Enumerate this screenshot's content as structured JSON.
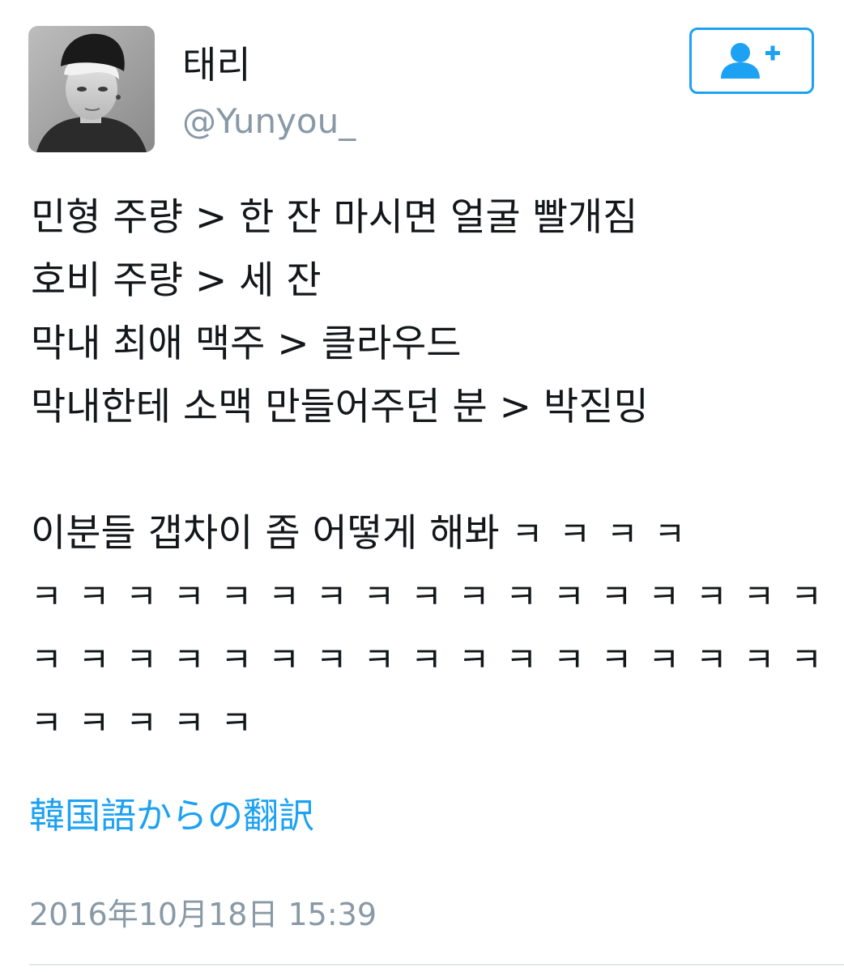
{
  "user": {
    "display_name": "태리",
    "handle": "@Yunyou_"
  },
  "follow_button": {
    "icon": "add-user-icon",
    "color": "#1da1f2"
  },
  "tweet": {
    "lines": [
      "민형 주량 > 한 잔 마시면 얼굴 빨개짐",
      "호비 주량 > 세 잔",
      "막내 최애 맥주 > 클라우드",
      "막내한테 소맥 만들어주던 분 > 박짇밍"
    ],
    "closing_text": "이분들 갭차이 좀 어떻게 해봐 ",
    "closing_kk": "ㅋㅋㅋㅋ",
    "kk_lines": [
      "ㅋㅋㅋㅋㅋㅋㅋㅋㅋㅋㅋㅋㅋㅋㅋㅋㅋㅋ",
      "ㅋㅋㅋㅋㅋㅋㅋㅋㅋㅋㅋㅋㅋㅋㅋㅋㅋㅋ",
      "ㅋㅋㅋㅋㅋ"
    ]
  },
  "translate_link": "韓国語からの翻訳",
  "timestamp": "2016年10月18日 15:39",
  "colors": {
    "accent": "#1da1f2",
    "secondary_text": "#8899a6",
    "primary_text": "#14171a"
  }
}
